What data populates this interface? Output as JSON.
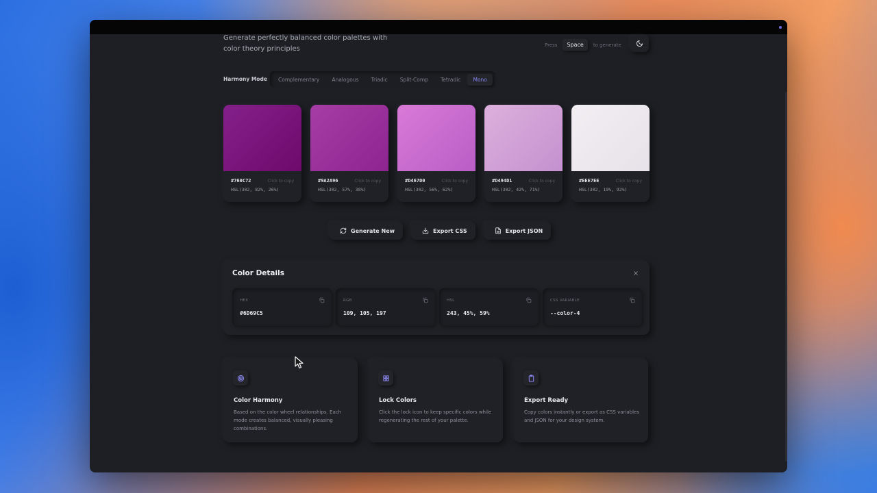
{
  "header": {
    "subtitle": "Generate perfectly balanced color palettes with color theory principles",
    "press_prefix": "Press",
    "press_key": "Space",
    "press_suffix": "to generate",
    "theme_icon": "moon-icon"
  },
  "harmony": {
    "label": "Harmony Mode",
    "modes": [
      "Complementary",
      "Analogous",
      "Triadic",
      "Split-Comp",
      "Tetradic",
      "Mono"
    ],
    "active": "Mono"
  },
  "palette": [
    {
      "hex": "#760C72",
      "hsl": "HSL(302, 82%, 26%)",
      "copy": "Click to copy",
      "color_a": "#84208a",
      "color_b": "#6e0a6c"
    },
    {
      "hex": "#9A2A96",
      "hsl": "HSL(302, 57%, 38%)",
      "copy": "Click to copy",
      "color_a": "#a63ca5",
      "color_b": "#8e2490"
    },
    {
      "hex": "#D467D0",
      "hsl": "HSL(302, 56%, 62%)",
      "copy": "Click to copy",
      "color_a": "#d97ad8",
      "color_b": "#b95ec6"
    },
    {
      "hex": "#D494D1",
      "hsl": "HSL(302, 42%, 71%)",
      "copy": "Click to copy",
      "color_a": "#dcb0dc",
      "color_b": "#c491cf"
    },
    {
      "hex": "#EEE7EE",
      "hsl": "HSL(302, 19%, 92%)",
      "copy": "Click to copy",
      "color_a": "#f2eef2",
      "color_b": "#e7e2e9"
    }
  ],
  "actions": {
    "generate": "Generate New",
    "export_css": "Export CSS",
    "export_json": "Export JSON"
  },
  "details": {
    "title": "Color Details",
    "fields": [
      {
        "label": "HEX",
        "value": "#6D69C5"
      },
      {
        "label": "RGB",
        "value": "109, 105, 197"
      },
      {
        "label": "HSL",
        "value": "243, 45%, 59%"
      },
      {
        "label": "CSS VARIABLE",
        "value": "--color-4"
      }
    ]
  },
  "features": [
    {
      "title": "Color Harmony",
      "desc": "Based on the color wheel relationships. Each mode creates balanced, visually pleasing combinations.",
      "icon": "target-icon"
    },
    {
      "title": "Lock Colors",
      "desc": "Click the lock icon to keep specific colors while regenerating the rest of your palette.",
      "icon": "lock-icon"
    },
    {
      "title": "Export Ready",
      "desc": "Copy colors instantly or export as CSS variables and JSON for your design system.",
      "icon": "clipboard-icon"
    }
  ],
  "colors": {
    "accent": "#8B86F0",
    "window_bg": "#1D1F24",
    "card_bg": "#1F2126"
  }
}
